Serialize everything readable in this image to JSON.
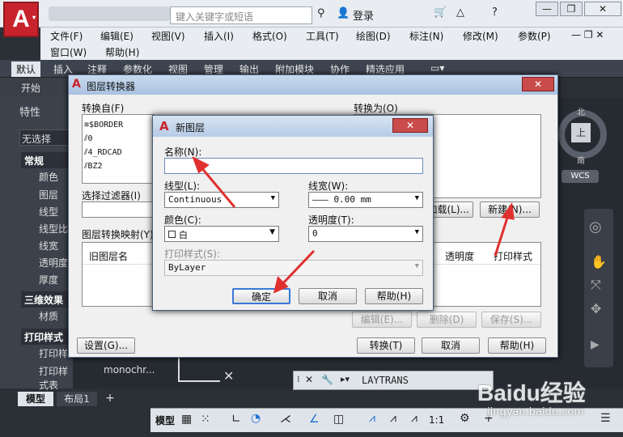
{
  "app": {
    "search_placeholder": "键入关键字或短语",
    "login": "登录"
  },
  "menus": [
    "文件(F)",
    "编辑(E)",
    "视图(V)",
    "插入(I)",
    "格式(O)",
    "工具(T)",
    "绘图(D)",
    "标注(N)",
    "修改(M)",
    "参数(P)",
    "窗口(W)",
    "帮助(H)"
  ],
  "ribbon_tabs": [
    "默认",
    "插入",
    "注释",
    "参数化",
    "视图",
    "管理",
    "输出",
    "附加模块",
    "协作",
    "精选应用"
  ],
  "file_tab": "开始",
  "palette": {
    "title": "特性",
    "selection": "无选择",
    "general": "常规",
    "items_general": [
      "颜色",
      "图层",
      "线型",
      "线型比",
      "线宽",
      "透明度",
      "厚度"
    ],
    "three_d": "三维效果",
    "items_3d": [
      "材质"
    ],
    "print_style": "打印样式",
    "items_print": [
      "打印样",
      "打印样式表"
    ],
    "print_table_value": "monochr..."
  },
  "layer_translator": {
    "title": "图层转换器",
    "convert_from": "转换自(F)",
    "convert_to": "转换为(O)",
    "layers": [
      "$BORDER",
      "0",
      "4_RDCAD",
      "BZ2"
    ],
    "selection_filter": "选择过滤器(I)",
    "map_label": "图层转换映射(Y)",
    "col_old": "旧图层名",
    "col_transparency": "透明度",
    "col_plotstyle": "打印样式",
    "load_button": "加载(L)...",
    "new_button": "新建(N)...",
    "edit_button": "编辑(E)...",
    "delete_button": "删除(D)",
    "save_button": "保存(S)...",
    "settings_button": "设置(G)...",
    "translate_button": "转换(T)",
    "cancel_button": "取消",
    "help_button": "帮助(H)"
  },
  "new_layer": {
    "title": "新图层",
    "name_label": "名称(N):",
    "name_value": "",
    "linetype_label": "线型(L):",
    "linetype_value": "Continuous",
    "lineweight_label": "线宽(W):",
    "lineweight_value": "——— 0.00 mm",
    "color_label": "颜色(C):",
    "color_value": "白",
    "transparency_label": "透明度(T):",
    "transparency_value": "0",
    "plotstyle_label": "打印样式(S):",
    "plotstyle_value": "ByLayer",
    "ok_button": "确定",
    "cancel_button": "取消",
    "help_button": "帮助(H)"
  },
  "viewcube": {
    "north": "北",
    "south": "南",
    "top": "上",
    "wcs": "WCS"
  },
  "layout_tabs": [
    "模型",
    "布局1"
  ],
  "command": {
    "text": "LAYTRANS"
  },
  "status": {
    "model": "模型",
    "scale": "1:1"
  },
  "watermark": {
    "brand": "Baidu经验",
    "url": "jingyan.baidu.com"
  },
  "colors": {
    "accent_red": "#e0302f",
    "dialog_bg": "#f0f0f0",
    "title_blue": "#b6cbe6"
  }
}
